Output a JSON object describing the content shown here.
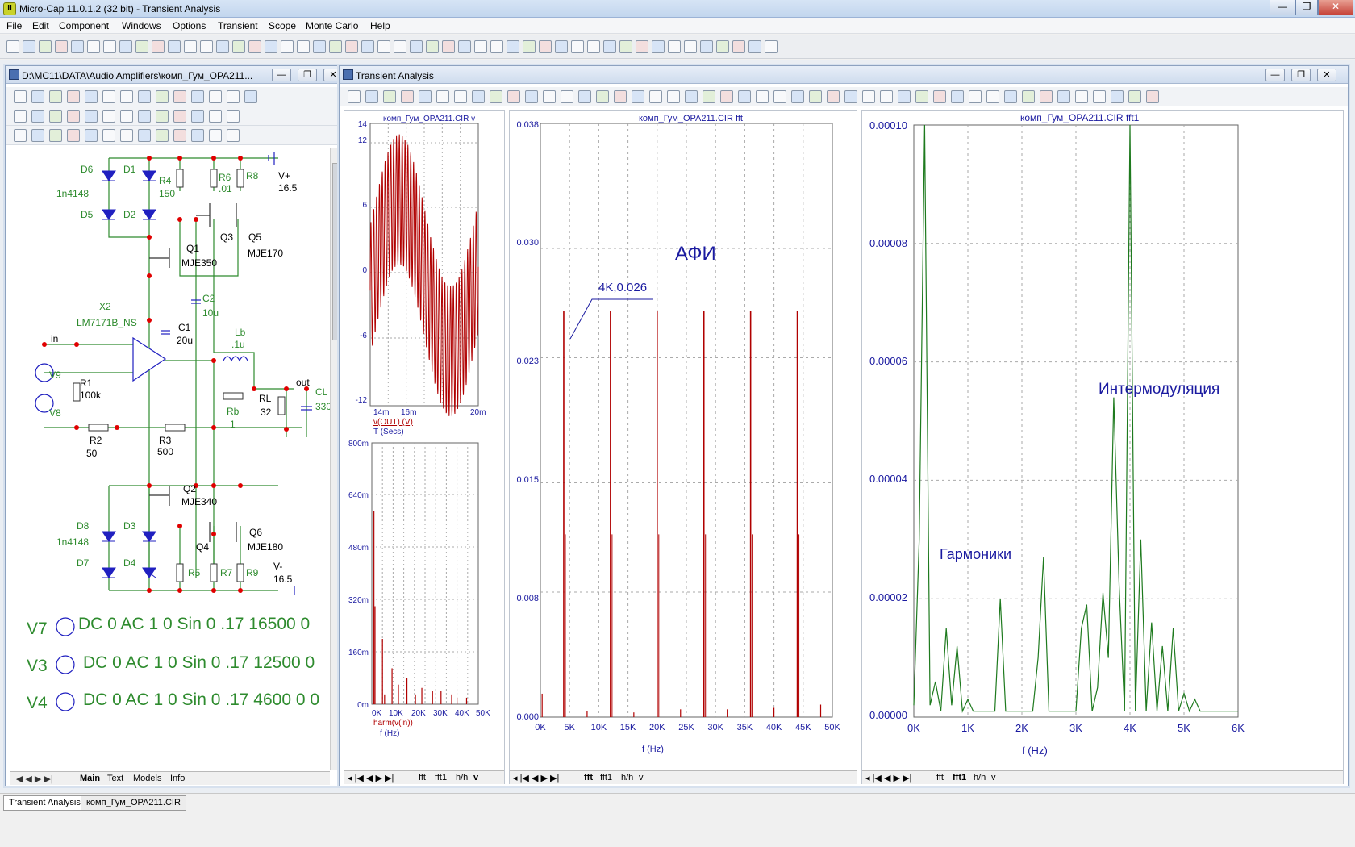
{
  "app": {
    "title": "Micro-Cap 11.0.1.2 (32 bit) - Transient Analysis",
    "icon_letter": "II"
  },
  "window_buttons": {
    "min": "—",
    "max": "❐",
    "close": "✕"
  },
  "menu": [
    "File",
    "Edit",
    "Component",
    "Windows",
    "Options",
    "Transient",
    "Scope",
    "Monte Carlo",
    "Help"
  ],
  "schematic": {
    "title": "D:\\MC11\\DATA\\Audio Amplifiers\\комп_Гум_OPA211...",
    "tabs": [
      "Main",
      "Text",
      "Models",
      "Info"
    ],
    "labels": {
      "D6": "D6",
      "D1": "D1",
      "R4": "R4",
      "R4v": "150",
      "R6": "R6",
      "R6v": ".01",
      "R8": "R8",
      "Vp": "V+",
      "Vpv": "16.5",
      "d4148a": "1n4148",
      "D5": "D5",
      "D2": "D2",
      "Q3": "Q3",
      "Q5": "Q5",
      "Q5m": "MJE170",
      "Q1": "Q1",
      "Q1m": "MJE350",
      "C2": "C2",
      "C2v": "10u",
      "X2": "X2",
      "X2m": "LM7171B_NS",
      "C1": "C1",
      "C1v": "20u",
      "Lb": "Lb",
      "Lbv": ".1u",
      "in": "in",
      "out": "out",
      "V9": "V9",
      "R1": "R1",
      "R1v": "100k",
      "CL": "CL",
      "CLv": "330",
      "RL": "RL",
      "RLv": "32",
      "V8": "V8",
      "Rb": "Rb",
      "Rbv": "1",
      "R2": "R2",
      "R2v": "50",
      "R3": "R3",
      "R3v": "500",
      "Q2": "Q2",
      "Q2m": "MJE340",
      "D8": "D8",
      "D3": "D3",
      "Q6": "Q6",
      "d4148b": "1n4148",
      "Q4": "Q4",
      "Q6m": "MJE180",
      "D7": "D7",
      "D4": "D4",
      "R5": "R5",
      "R7": "R7",
      "R9": "R9",
      "Vm": "V-",
      "Vmv": "16.5"
    },
    "sources": [
      {
        "name": "V7",
        "spec": "DC 0 AC 1 0 Sin 0 .17 16500 0"
      },
      {
        "name": "V3",
        "spec": "DC 0 AC 1 0 Sin 0 .17 12500 0"
      },
      {
        "name": "V4",
        "spec": "DC 0 AC 1 0 Sin 0 .17 4600 0 0"
      }
    ]
  },
  "analysis": {
    "title": "Transient Analysis",
    "plot1": {
      "title": "комп_Гум_OPA211.CIR v",
      "yticks": [
        "14",
        "12",
        "6",
        "0",
        "-6",
        "-12"
      ],
      "xticks": [
        "14m",
        "16m",
        "20m"
      ],
      "trace": "v(OUT) (V)",
      "xlabel": "T (Secs)",
      "tabs": [
        "fft",
        "fft1",
        "h/h",
        "v"
      ],
      "chart_data": {
        "type": "line",
        "x_range": [
          0.014,
          0.02
        ],
        "y_range": [
          -12,
          14
        ],
        "description": "carrier modulated by low-frequency sine"
      }
    },
    "plot1b": {
      "yticks": [
        "800m",
        "640m",
        "480m",
        "320m",
        "160m",
        "0m"
      ],
      "xticks": [
        "0K",
        "10K",
        "20K",
        "30K",
        "40K",
        "50K"
      ],
      "trace": "harm(v(in))",
      "xlabel": "f (Hz)"
    },
    "plot2": {
      "title": "комп_Гум_OPA211.CIR fft",
      "yticks": [
        "0.038",
        "0.030",
        "0.023",
        "0.015",
        "0.008",
        "0.000"
      ],
      "xticks": [
        "0K",
        "5K",
        "10K",
        "15K",
        "20K",
        "25K",
        "30K",
        "35K",
        "40K",
        "45K",
        "50K"
      ],
      "xlabel": "f (Hz)",
      "annotation": "АФИ",
      "point_label": "4K,0.026",
      "tabs": [
        "fft",
        "fft1",
        "h/h",
        "v"
      ],
      "chart_data": {
        "type": "bar",
        "x": [
          4000,
          12000,
          20000,
          28000,
          36000,
          44000
        ],
        "values": [
          0.026,
          0.026,
          0.026,
          0.026,
          0.026,
          0.026
        ],
        "xlim": [
          0,
          50000
        ],
        "ylim": [
          0,
          0.038
        ]
      }
    },
    "plot3": {
      "title": "комп_Гум_OPA211.CIR fft1",
      "yticks": [
        "0.00010",
        "0.00008",
        "0.00006",
        "0.00004",
        "0.00002",
        "0.00000"
      ],
      "xticks": [
        "0K",
        "1K",
        "2K",
        "3K",
        "4K",
        "5K",
        "6K"
      ],
      "xlabel": "f (Hz)",
      "annotation1": "Интермодуляция",
      "annotation2": "Гармоники",
      "tabs": [
        "fft",
        "fft1",
        "h/h",
        "v"
      ],
      "chart_data": {
        "type": "line",
        "x": [
          0,
          100,
          200,
          300,
          400,
          500,
          600,
          700,
          800,
          900,
          1000,
          1100,
          1200,
          1300,
          1400,
          1500,
          1600,
          1700,
          1800,
          1900,
          2000,
          2100,
          2200,
          2300,
          2400,
          2500,
          2600,
          2700,
          2800,
          2900,
          3000,
          3100,
          3200,
          3300,
          3400,
          3500,
          3600,
          3700,
          3800,
          3900,
          4000,
          4100,
          4200,
          4300,
          4400,
          4500,
          4600,
          4700,
          4800,
          4900,
          5000,
          5100,
          5200,
          5300,
          5400,
          5500,
          5600,
          5700,
          5800,
          5900,
          6000
        ],
        "values": [
          2e-06,
          3e-05,
          0.0001,
          2e-06,
          6e-06,
          1e-06,
          1.5e-05,
          2e-06,
          1.2e-05,
          1e-06,
          3e-06,
          1e-06,
          1e-06,
          1e-06,
          1e-06,
          1e-06,
          2e-05,
          1e-06,
          1e-06,
          1e-06,
          1e-06,
          1e-06,
          1e-06,
          1e-05,
          2.7e-05,
          1e-06,
          1e-06,
          1e-06,
          1e-06,
          1e-06,
          1e-06,
          1.5e-05,
          1.9e-05,
          1e-06,
          5e-06,
          2.1e-05,
          1e-05,
          5.4e-05,
          2.2e-05,
          1e-06,
          0.0001,
          1e-06,
          3e-05,
          1e-06,
          1.6e-05,
          1e-06,
          1.2e-05,
          1e-06,
          1.5e-05,
          1e-06,
          4e-06,
          1e-06,
          3e-06,
          1e-06,
          1e-06,
          1e-06,
          1e-06,
          1e-06,
          1e-06,
          1e-06,
          1e-06
        ],
        "xlim": [
          0,
          6000
        ],
        "ylim": [
          0,
          0.0001
        ]
      }
    }
  },
  "statusbar": {
    "tabs": [
      "Transient Analysis",
      "комп_Гум_OPA211.CIR"
    ]
  },
  "colors": {
    "trace_red": "#b00000",
    "trace_green": "#1e7a1e",
    "axis_blue": "#1a1aa0",
    "schem_green": "#2e8b2e",
    "wire": "#2e8b2e",
    "node": "#e00000",
    "part_blue": "#2020c0"
  }
}
